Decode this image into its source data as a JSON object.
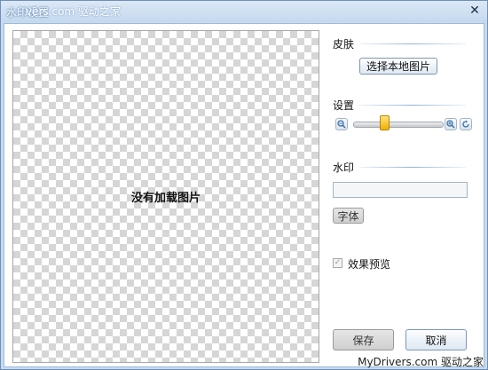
{
  "window": {
    "title": "水印设置",
    "watermark_text": "vers.com 驱动之家",
    "close_glyph": "✕"
  },
  "preview": {
    "empty_text": "没有加载图片"
  },
  "skin": {
    "label": "皮肤",
    "select_button": "选择本地图片"
  },
  "settings": {
    "label": "设置",
    "zoom_out_icon": "zoom-out-icon",
    "zoom_in_icon": "zoom-in-icon",
    "rotate_icon": "rotate-icon",
    "slider_value_fraction": 0.35
  },
  "watermark": {
    "label": "水印",
    "input_value": "",
    "font_button": "字体"
  },
  "effect_preview": {
    "label": "效果预览",
    "checked": true
  },
  "footer": {
    "save_button": "保存",
    "cancel_button": "取消",
    "site_watermark": "MyDrivers.com 驱动之家"
  },
  "colors": {
    "frame": "#c7daef",
    "accent": "#8fb3dd",
    "slider_thumb": "#f0b000"
  }
}
